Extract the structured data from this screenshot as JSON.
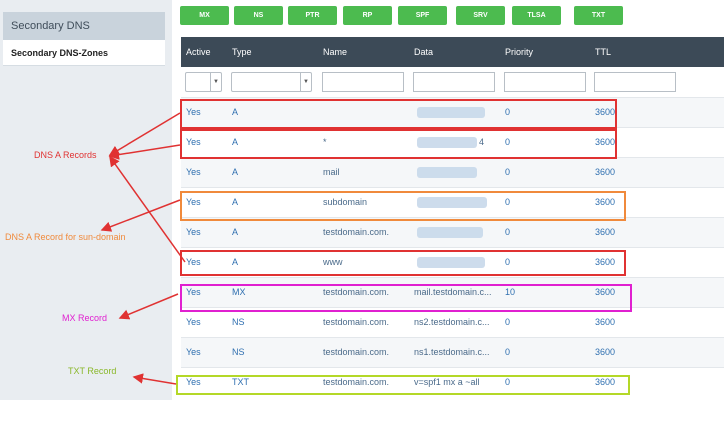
{
  "sidebar": {
    "header": "Secondary DNS",
    "items": [
      {
        "label": "Secondary DNS-Zones"
      }
    ]
  },
  "toolbar": {
    "buttons": [
      "MX",
      "NS",
      "PTR",
      "RP",
      "SPF",
      "SRV",
      "TLSA",
      "TXT"
    ]
  },
  "table": {
    "columns": [
      "Active",
      "Type",
      "Name",
      "Data",
      "Priority",
      "TTL"
    ],
    "rows": [
      {
        "active": "Yes",
        "type": "A",
        "name": "",
        "data": "",
        "priority": "0",
        "ttl": "3600"
      },
      {
        "active": "Yes",
        "type": "A",
        "name": "*",
        "data": "4",
        "priority": "0",
        "ttl": "3600"
      },
      {
        "active": "Yes",
        "type": "A",
        "name": "mail",
        "data": "",
        "priority": "0",
        "ttl": "3600"
      },
      {
        "active": "Yes",
        "type": "A",
        "name": "subdomain",
        "data": "",
        "priority": "0",
        "ttl": "3600"
      },
      {
        "active": "Yes",
        "type": "A",
        "name": "testdomain.com.",
        "data": "",
        "priority": "0",
        "ttl": "3600"
      },
      {
        "active": "Yes",
        "type": "A",
        "name": "www",
        "data": "",
        "priority": "0",
        "ttl": "3600"
      },
      {
        "active": "Yes",
        "type": "MX",
        "name": "testdomain.com.",
        "data": "mail.testdomain.c...",
        "priority": "10",
        "ttl": "3600"
      },
      {
        "active": "Yes",
        "type": "NS",
        "name": "testdomain.com.",
        "data": "ns2.testdomain.c...",
        "priority": "0",
        "ttl": "3600"
      },
      {
        "active": "Yes",
        "type": "NS",
        "name": "testdomain.com.",
        "data": "ns1.testdomain.c...",
        "priority": "0",
        "ttl": "3600"
      },
      {
        "active": "Yes",
        "type": "TXT",
        "name": "testdomain.com.",
        "data": "v=spf1 mx a ~all",
        "priority": "0",
        "ttl": "3600"
      }
    ]
  },
  "annotations": {
    "dns_a": "DNS A Records",
    "dns_a_sub": "DNS A Record for sun-domain",
    "mx": "MX Record",
    "txt": "TXT Record"
  },
  "colors": {
    "red": "#e03232",
    "orange": "#f08a3c",
    "magenta": "#e020d0",
    "lime": "#b4d828",
    "button": "#4cbb4f",
    "header": "#3c4a57"
  }
}
